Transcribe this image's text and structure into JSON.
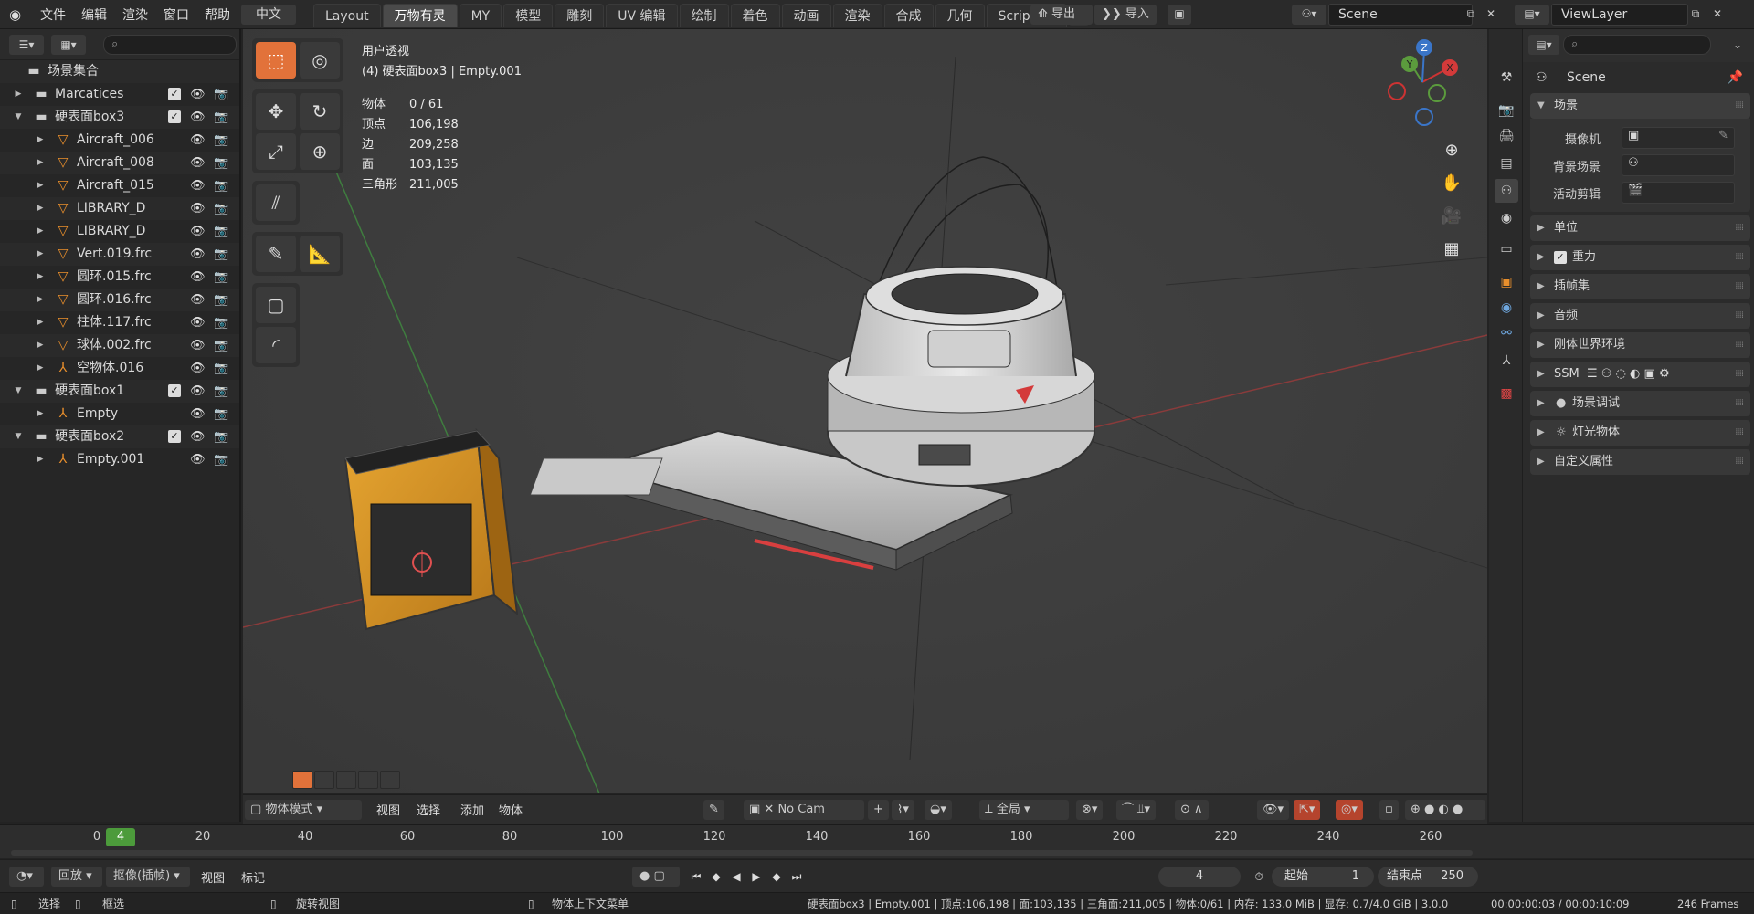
{
  "menu": {
    "file": "文件",
    "edit": "编辑",
    "render": "渲染",
    "window": "窗口",
    "help": "帮助",
    "lang": "中文"
  },
  "workspaces": [
    "Layout",
    "万物有灵",
    "MY",
    "模型",
    "雕刻",
    "UV 编辑",
    "绘制",
    "着色",
    "动画",
    "渲染",
    "合成",
    "几何",
    "Scripting"
  ],
  "active_workspace": "万物有灵",
  "topbar": {
    "export": "导出",
    "import": "导入",
    "scene": "Scene",
    "view_layer": "ViewLayer"
  },
  "outliner": {
    "search_placeholder": "",
    "rows": [
      {
        "label": "场景集合",
        "type": "root"
      },
      {
        "label": "Marcatices",
        "type": "collection",
        "depth": 1,
        "expanded": false,
        "checked": true
      },
      {
        "label": "硬表面box3",
        "type": "collection",
        "depth": 1,
        "expanded": true,
        "checked": true
      },
      {
        "label": "Aircraft_006",
        "type": "mesh",
        "depth": 2
      },
      {
        "label": "Aircraft_008",
        "type": "mesh",
        "depth": 2
      },
      {
        "label": "Aircraft_015",
        "type": "mesh",
        "depth": 2
      },
      {
        "label": "LIBRARY_D",
        "type": "mesh",
        "depth": 2
      },
      {
        "label": "LIBRARY_D",
        "type": "mesh",
        "depth": 2
      },
      {
        "label": "Vert.019.frc",
        "type": "mesh",
        "depth": 2
      },
      {
        "label": "圆环.015.frc",
        "type": "mesh",
        "depth": 2
      },
      {
        "label": "圆环.016.frc",
        "type": "mesh",
        "depth": 2
      },
      {
        "label": "柱体.117.frc",
        "type": "mesh",
        "depth": 2
      },
      {
        "label": "球体.002.frc",
        "type": "mesh",
        "depth": 2
      },
      {
        "label": "空物体.016",
        "type": "empty",
        "depth": 2
      },
      {
        "label": "硬表面box1",
        "type": "collection",
        "depth": 1,
        "expanded": true,
        "checked": true
      },
      {
        "label": "Empty",
        "type": "empty",
        "depth": 2
      },
      {
        "label": "硬表面box2",
        "type": "collection",
        "depth": 1,
        "expanded": true,
        "checked": true
      },
      {
        "label": "Empty.001",
        "type": "empty",
        "depth": 2
      }
    ]
  },
  "viewport": {
    "view_name": "用户透视",
    "context": "(4) 硬表面box3 | Empty.001",
    "stats": [
      {
        "k": "物体",
        "v": "0 / 61"
      },
      {
        "k": "顶点",
        "v": "106,198"
      },
      {
        "k": "边",
        "v": "209,258"
      },
      {
        "k": "面",
        "v": "103,135"
      },
      {
        "k": "三角形",
        "v": "211,005"
      }
    ],
    "gizmo": {
      "x": "X",
      "y": "Y",
      "z": "Z"
    },
    "header": {
      "mode": "物体模式",
      "view": "视图",
      "select": "选择",
      "add": "添加",
      "object": "物体",
      "camera": "No Cam",
      "transform": "全局"
    }
  },
  "properties": {
    "scene_name": "Scene",
    "open_panel": "场景",
    "fields": [
      {
        "label": "摄像机"
      },
      {
        "label": "背景场景"
      },
      {
        "label": "活动剪辑"
      }
    ],
    "panels": [
      "单位",
      "重力",
      "插帧集",
      "音频",
      "刚体世界环境",
      "SSM",
      "场景调试",
      "灯光物体",
      "自定义属性"
    ]
  },
  "timeline": {
    "ticks": [
      "0",
      "20",
      "40",
      "60",
      "80",
      "100",
      "120",
      "140",
      "160",
      "180",
      "200",
      "220",
      "240",
      "260"
    ],
    "current_frame": "4"
  },
  "playbar": {
    "playback": "回放",
    "keying": "抠像(插帧)",
    "view": "视图",
    "marker": "标记",
    "frame": "4",
    "start_label": "起始",
    "start": "1",
    "end_label": "结束点",
    "end": "250"
  },
  "status": {
    "select": "选择",
    "box_select": "框选",
    "rotate": "旋转视图",
    "context_menu": "物体上下文菜单",
    "info": "硬表面box3 | Empty.001 | 顶点:106,198 | 面:103,135 | 三角面:211,005 | 物体:0/61 | 内存: 133.0 MiB | 显存: 0.7/4.0 GiB | 3.0.0",
    "time": "00:00:00:03 / 00:00:10:09",
    "frames": "246 Frames"
  }
}
